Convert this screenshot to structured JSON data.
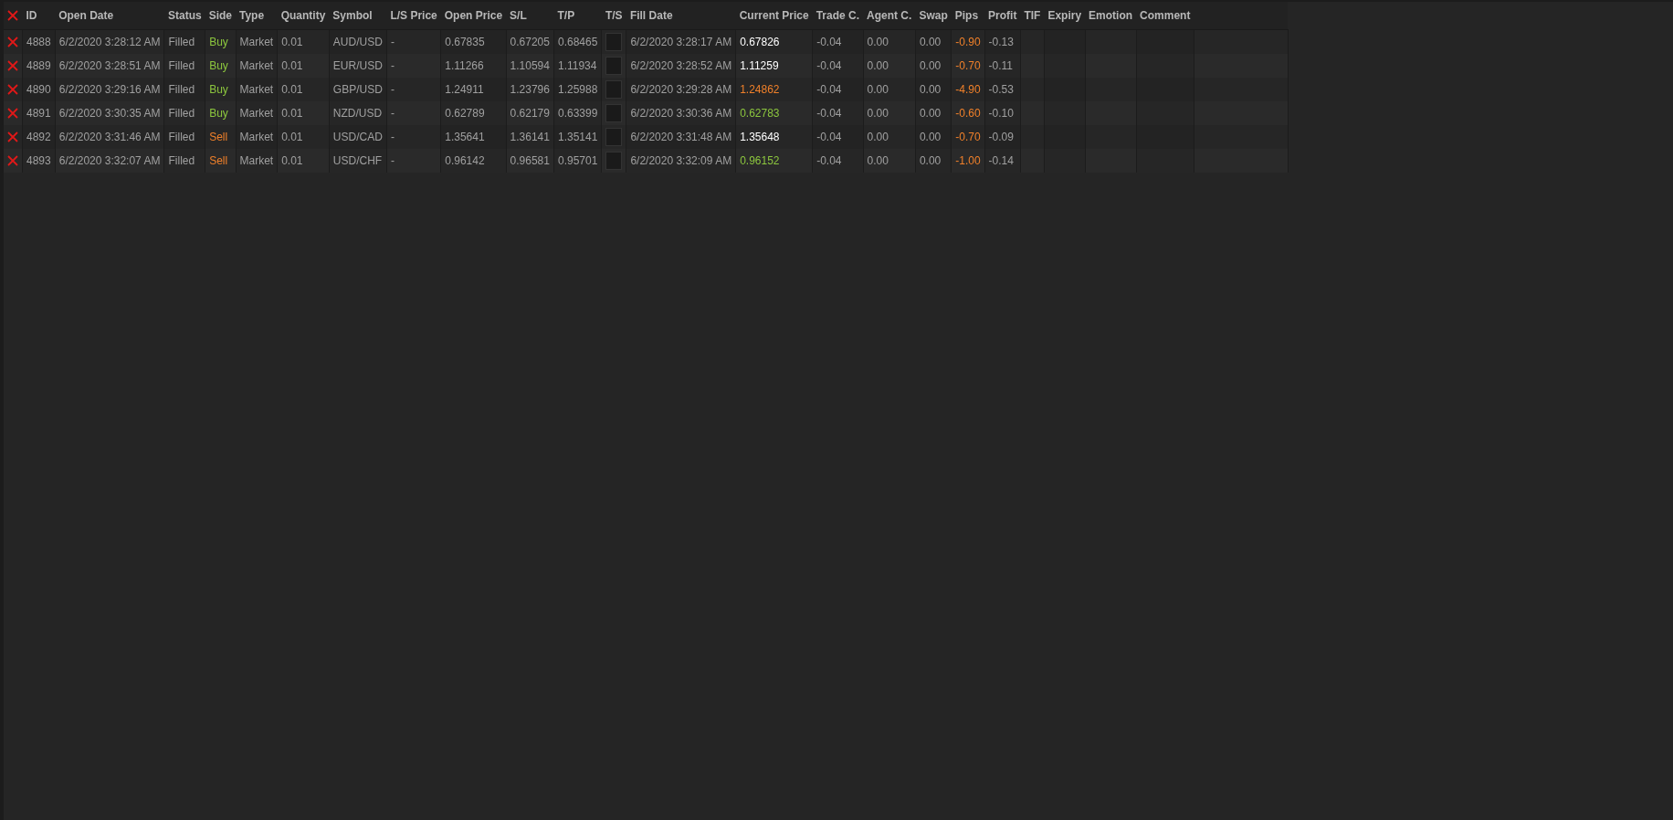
{
  "table": {
    "columns": [
      "ID",
      "Open Date",
      "Status",
      "Side",
      "Type",
      "Quantity",
      "Symbol",
      "L/S Price",
      "Open Price",
      "S/L",
      "T/P",
      "T/S",
      "Fill Date",
      "Current Price",
      "Trade C.",
      "Agent C.",
      "Swap",
      "Pips",
      "Profit",
      "TIF",
      "Expiry",
      "Emotion",
      "Comment"
    ],
    "rows": [
      {
        "id": "4888",
        "open_date": "6/2/2020 3:28:12 AM",
        "status": "Filled",
        "side": {
          "text": "Buy",
          "color": "#8cc63e"
        },
        "type": "Market",
        "quantity": "0.01",
        "symbol": "AUD/USD",
        "ls_price": "-",
        "open_price": "0.67835",
        "sl": "0.67205",
        "tp": "0.68465",
        "ts_checked": false,
        "fill_date": "6/2/2020 3:28:17 AM",
        "current_price": {
          "text": "0.67826",
          "color": "#ffffff"
        },
        "trade_c": "-0.04",
        "agent_c": "0.00",
        "swap": "0.00",
        "pips": "-0.90",
        "profit": "-0.13"
      },
      {
        "id": "4889",
        "open_date": "6/2/2020 3:28:51 AM",
        "status": "Filled",
        "side": {
          "text": "Buy",
          "color": "#8cc63e"
        },
        "type": "Market",
        "quantity": "0.01",
        "symbol": "EUR/USD",
        "ls_price": "-",
        "open_price": "1.11266",
        "sl": "1.10594",
        "tp": "1.11934",
        "ts_checked": false,
        "fill_date": "6/2/2020 3:28:52 AM",
        "current_price": {
          "text": "1.11259",
          "color": "#ffffff"
        },
        "trade_c": "-0.04",
        "agent_c": "0.00",
        "swap": "0.00",
        "pips": "-0.70",
        "profit": "-0.11"
      },
      {
        "id": "4890",
        "open_date": "6/2/2020 3:29:16 AM",
        "status": "Filled",
        "side": {
          "text": "Buy",
          "color": "#8cc63e"
        },
        "type": "Market",
        "quantity": "0.01",
        "symbol": "GBP/USD",
        "ls_price": "-",
        "open_price": "1.24911",
        "sl": "1.23796",
        "tp": "1.25988",
        "ts_checked": false,
        "fill_date": "6/2/2020 3:29:28 AM",
        "current_price": {
          "text": "1.24862",
          "color": "#f0802a"
        },
        "trade_c": "-0.04",
        "agent_c": "0.00",
        "swap": "0.00",
        "pips": "-4.90",
        "profit": "-0.53"
      },
      {
        "id": "4891",
        "open_date": "6/2/2020 3:30:35 AM",
        "status": "Filled",
        "side": {
          "text": "Buy",
          "color": "#8cc63e"
        },
        "type": "Market",
        "quantity": "0.01",
        "symbol": "NZD/USD",
        "ls_price": "-",
        "open_price": "0.62789",
        "sl": "0.62179",
        "tp": "0.63399",
        "ts_checked": false,
        "fill_date": "6/2/2020 3:30:36 AM",
        "current_price": {
          "text": "0.62783",
          "color": "#8cc63e"
        },
        "trade_c": "-0.04",
        "agent_c": "0.00",
        "swap": "0.00",
        "pips": "-0.60",
        "profit": "-0.10"
      },
      {
        "id": "4892",
        "open_date": "6/2/2020 3:31:46 AM",
        "status": "Filled",
        "side": {
          "text": "Sell",
          "color": "#f0802a"
        },
        "type": "Market",
        "quantity": "0.01",
        "symbol": "USD/CAD",
        "ls_price": "-",
        "open_price": "1.35641",
        "sl": "1.36141",
        "tp": "1.35141",
        "ts_checked": false,
        "fill_date": "6/2/2020 3:31:48 AM",
        "current_price": {
          "text": "1.35648",
          "color": "#ffffff"
        },
        "trade_c": "-0.04",
        "agent_c": "0.00",
        "swap": "0.00",
        "pips": "-0.70",
        "profit": "-0.09"
      },
      {
        "id": "4893",
        "open_date": "6/2/2020 3:32:07 AM",
        "status": "Filled",
        "side": {
          "text": "Sell",
          "color": "#f0802a"
        },
        "type": "Market",
        "quantity": "0.01",
        "symbol": "USD/CHF",
        "ls_price": "-",
        "open_price": "0.96142",
        "sl": "0.96581",
        "tp": "0.95701",
        "ts_checked": false,
        "fill_date": "6/2/2020 3:32:09 AM",
        "current_price": {
          "text": "0.96152",
          "color": "#8cc63e"
        },
        "trade_c": "-0.04",
        "agent_c": "0.00",
        "swap": "0.00",
        "pips": "-1.00",
        "profit": "-0.14"
      }
    ]
  }
}
